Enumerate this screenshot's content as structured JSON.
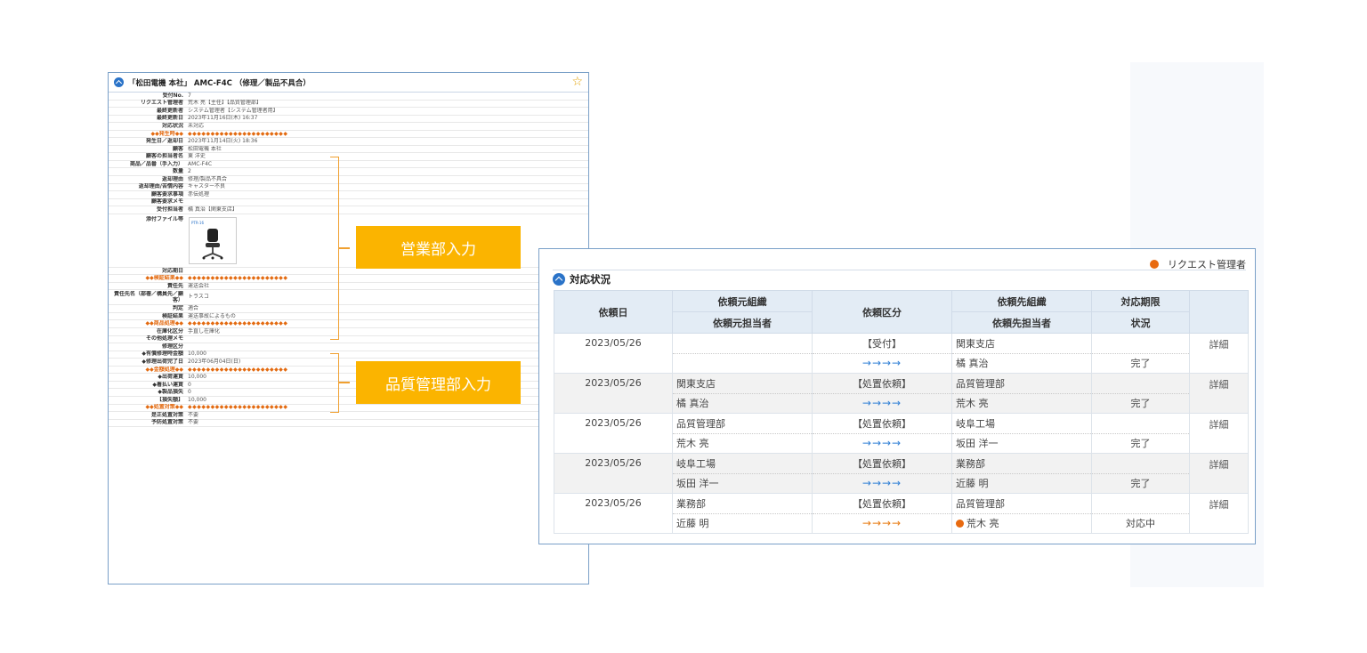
{
  "form": {
    "title": "「松田電機 本社」 AMC-F4C （修理／製品不具合）",
    "rows": [
      {
        "label": "受付No.",
        "value": "7"
      },
      {
        "label": "リクエスト管理者",
        "value": "荒木 亮【主任】【品質管理部】"
      },
      {
        "label": "最終更新者",
        "value": "システム管理者【システム管理者用】"
      },
      {
        "label": "最終更新日",
        "value": "2023年11月16日(木) 16:37"
      },
      {
        "label": "対応状況",
        "value": "未対応"
      },
      {
        "label": "◆◆発生時◆◆",
        "value": "◆◆◆◆◆◆◆◆◆◆◆◆◆◆◆◆◆◆◆◆◆◆"
      },
      {
        "label": "発生日／返却日",
        "value": "2023年11月14日(火) 18:36"
      },
      {
        "label": "顧客",
        "value": "松田電機 本社"
      },
      {
        "label": "顧客の担当者名",
        "value": "東 洋史"
      },
      {
        "label": "商品／品番（手入力）",
        "value": "AMC-F4C"
      },
      {
        "label": "数量",
        "value": "2"
      },
      {
        "label": "返却理由",
        "value": "修理/製品不具合"
      },
      {
        "label": "返却理由/苦情内容",
        "value": "キャスター不良"
      },
      {
        "label": "顧客要求事項",
        "value": "赤伝処理"
      },
      {
        "label": "顧客要求メモ",
        "value": ""
      },
      {
        "label": "受付担当者",
        "value": "橘 真治【関東支店】"
      },
      {
        "label": "添付ファイル等",
        "value": "PTR-16"
      },
      {
        "label": "対応期日",
        "value": ""
      },
      {
        "label": "◆◆検証結果◆◆",
        "value": "◆◆◆◆◆◆◆◆◆◆◆◆◆◆◆◆◆◆◆◆◆◆"
      },
      {
        "label": "責任先",
        "value": "運送会社"
      },
      {
        "label": "責任先名（部署／構員先／顧客）",
        "value": "トラスコ"
      },
      {
        "label": "判定",
        "value": "適合"
      },
      {
        "label": "検証結果",
        "value": "運送事故によるもの"
      },
      {
        "label": "◆◆商品処理◆◆",
        "value": "◆◆◆◆◆◆◆◆◆◆◆◆◆◆◆◆◆◆◆◆◆◆"
      },
      {
        "label": "在庫化区分",
        "value": "手直し在庫化"
      },
      {
        "label": "その他処理メモ",
        "value": ""
      },
      {
        "label": "修理区分",
        "value": ""
      },
      {
        "label": "◆有償修理時金額",
        "value": "10,000"
      },
      {
        "label": "◆修理出荷完了日",
        "value": "2023年06月04日(日)"
      },
      {
        "label": "◆◆金額処理◆◆",
        "value": "◆◆◆◆◆◆◆◆◆◆◆◆◆◆◆◆◆◆◆◆◆◆"
      },
      {
        "label": "◆出荷運賃",
        "value": "10,000"
      },
      {
        "label": "◆着払い運賃",
        "value": "0"
      },
      {
        "label": "◆製品損失",
        "value": "0"
      },
      {
        "label": "【損失額】",
        "value": "10,000"
      },
      {
        "label": "◆◆処置対策◆◆",
        "value": "◆◆◆◆◆◆◆◆◆◆◆◆◆◆◆◆◆◆◆◆◆◆"
      },
      {
        "label": "是正処置対策",
        "value": "不要"
      },
      {
        "label": "予防処置対策",
        "value": "不要"
      }
    ]
  },
  "callouts": {
    "sales": "営業部入力",
    "quality": "品質管理部入力"
  },
  "status": {
    "legend": "リクエスト管理者",
    "title": "対応状況",
    "headers": {
      "date": "依頼日",
      "from_org": "依頼元組織",
      "from_person": "依頼元担当者",
      "type": "依頼区分",
      "to_org": "依頼先組織",
      "to_person": "依頼先担当者",
      "deadline": "対応期限",
      "state": "状況"
    },
    "rows": [
      {
        "date": "2023/05/26",
        "from_org": "",
        "from_person": "",
        "type": "【受付】",
        "arrows": "→→→→",
        "to_org": "関東支店",
        "to_person": "橘 真治",
        "deadline": "",
        "state": "完了",
        "detail": "詳細"
      },
      {
        "date": "2023/05/26",
        "from_org": "関東支店",
        "from_person": "橘 真治",
        "type": "【処置依頼】",
        "arrows": "→→→→",
        "to_org": "品質管理部",
        "to_person": "荒木 亮",
        "deadline": "",
        "state": "完了",
        "detail": "詳細"
      },
      {
        "date": "2023/05/26",
        "from_org": "品質管理部",
        "from_person": "荒木 亮",
        "type": "【処置依頼】",
        "arrows": "→→→→",
        "to_org": "岐阜工場",
        "to_person": "坂田 洋一",
        "deadline": "",
        "state": "完了",
        "detail": "詳細"
      },
      {
        "date": "2023/05/26",
        "from_org": "岐阜工場",
        "from_person": "坂田 洋一",
        "type": "【処置依頼】",
        "arrows": "→→→→",
        "to_org": "業務部",
        "to_person": "近藤 明",
        "deadline": "",
        "state": "完了",
        "detail": "詳細"
      },
      {
        "date": "2023/05/26",
        "from_org": "業務部",
        "from_person": "近藤 明",
        "type": "【処置依頼】",
        "arrows": "→→→→",
        "to_org": "品質管理部",
        "to_person": "荒木 亮",
        "deadline": "",
        "state": "対応中",
        "detail": "詳細"
      }
    ]
  },
  "colors": {
    "accent_orange": "#fbb400",
    "arrow_blue": "#2f7fd6",
    "arrow_active": "#e87a10",
    "header_blue": "#e3ecf5"
  }
}
